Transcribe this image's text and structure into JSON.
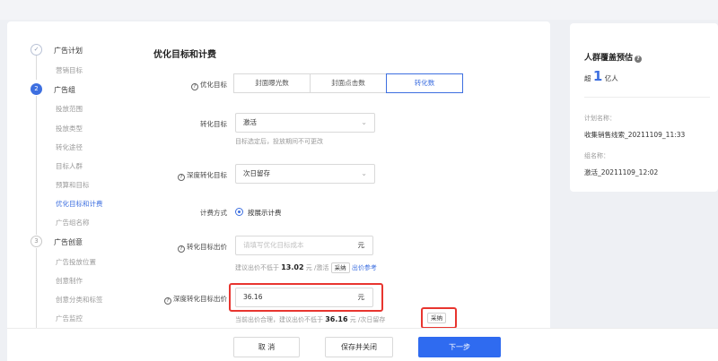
{
  "steps": [
    {
      "index": "✓",
      "title": "广告计划",
      "subs": [
        "营销目标"
      ]
    },
    {
      "index": "2",
      "title": "广告组",
      "subs": [
        "投放范围",
        "投放类型",
        "转化途径",
        "目标人群",
        "预算和目标",
        "优化目标和计费",
        "广告组名称"
      ],
      "active_sub": "优化目标和计费"
    },
    {
      "index": "3",
      "title": "广告创意",
      "subs": [
        "广告投放位置",
        "创意制作",
        "创意分类和标签",
        "广告监控"
      ]
    }
  ],
  "form": {
    "section_title": "优化目标和计费",
    "opt_target": {
      "label": "优化目标",
      "options": [
        "封面曝光数",
        "封面点击数",
        "转化数"
      ],
      "selected": "转化数"
    },
    "conv_target": {
      "label": "转化目标",
      "value": "激活",
      "hint": "目标选定后，投放期间不可更改"
    },
    "deep_conv_target": {
      "label": "深度转化目标",
      "value": "次日留存"
    },
    "billing": {
      "label": "计费方式",
      "option": "按展示计费"
    },
    "conv_bid": {
      "label": "转化目标出价",
      "placeholder": "请填写优化目标成本",
      "unit": "元",
      "hint_prefix": "建议出价不低于",
      "hint_value": "13.02",
      "hint_suffix": "元 /激活",
      "adopt": "采纳",
      "reference": "出价参考"
    },
    "deep_conv_bid": {
      "label": "深度转化目标出价",
      "value": "36.16",
      "unit": "元",
      "hint_prefix": "当前出价合理，建议出价不低于",
      "hint_value": "36.16",
      "hint_suffix": "元 /次日留存",
      "adopt": "采纳"
    }
  },
  "footer": {
    "cancel": "取 消",
    "save_close": "保存并关闭",
    "next": "下一步"
  },
  "estimate": {
    "title": "人群覆盖预估",
    "prefix": "超",
    "value": "1",
    "unit": "亿人",
    "plan_label": "计划名称：",
    "plan_value": "收集销售线索_20211109_11:33",
    "group_label": "组名称：",
    "group_value": "激活_20211109_12:02"
  },
  "colors": {
    "accent": "#3d6fe0",
    "primary_button": "#2f6bf0",
    "highlight": "#e8352f"
  }
}
